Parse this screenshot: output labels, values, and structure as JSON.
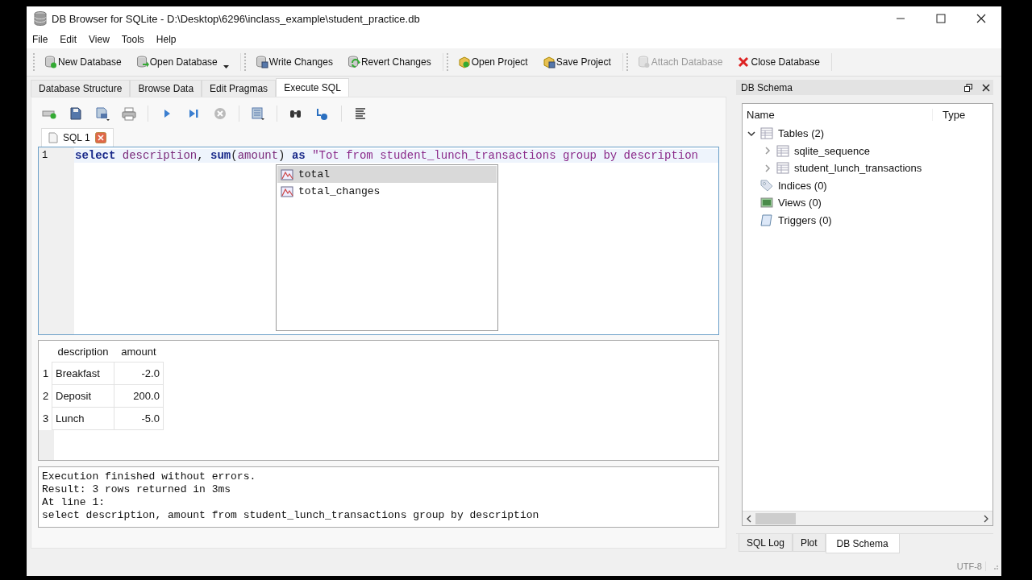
{
  "window": {
    "title": "DB Browser for SQLite - D:\\Desktop\\6296\\inclass_example\\student_practice.db"
  },
  "menu": [
    "File",
    "Edit",
    "View",
    "Tools",
    "Help"
  ],
  "toolbar": {
    "groups": [
      {
        "buttons": [
          {
            "label": "New Database",
            "disabled": false,
            "dropdown": false
          },
          {
            "label": "Open Database",
            "disabled": false,
            "dropdown": true
          }
        ]
      },
      {
        "buttons": [
          {
            "label": "Write Changes",
            "disabled": false,
            "dropdown": false
          },
          {
            "label": "Revert Changes",
            "disabled": false,
            "dropdown": false
          }
        ]
      },
      {
        "buttons": [
          {
            "label": "Open Project",
            "disabled": false,
            "dropdown": false
          },
          {
            "label": "Save Project",
            "disabled": false,
            "dropdown": false
          }
        ]
      },
      {
        "buttons": [
          {
            "label": "Attach Database",
            "disabled": true,
            "dropdown": false
          },
          {
            "label": "Close Database",
            "disabled": false,
            "dropdown": false
          }
        ]
      }
    ]
  },
  "main_tabs": [
    {
      "label": "Database Structure",
      "selected": false
    },
    {
      "label": "Browse Data",
      "selected": false
    },
    {
      "label": "Edit Pragmas",
      "selected": false
    },
    {
      "label": "Execute SQL",
      "selected": true
    }
  ],
  "sql_tabs": [
    {
      "label": "SQL 1"
    }
  ],
  "editor": {
    "lines": [
      {
        "number": "1",
        "tokens": [
          {
            "text": "select ",
            "kind": "keyword"
          },
          {
            "text": "description",
            "kind": "identifier"
          },
          {
            "text": ", ",
            "kind": "plain"
          },
          {
            "text": "sum",
            "kind": "keyword"
          },
          {
            "text": "(",
            "kind": "plain"
          },
          {
            "text": "amount",
            "kind": "identifier"
          },
          {
            "text": ") ",
            "kind": "plain"
          },
          {
            "text": "as ",
            "kind": "keyword"
          },
          {
            "text": "\"Tot from student_lunch_transactions group by description",
            "kind": "string"
          }
        ]
      }
    ]
  },
  "autocomplete": [
    {
      "label": "total",
      "selected": true
    },
    {
      "label": "total_changes",
      "selected": false
    }
  ],
  "results": {
    "columns": [
      "description",
      "amount"
    ],
    "rows": [
      {
        "number": "1",
        "cells": [
          "Breakfast",
          "-2.0"
        ]
      },
      {
        "number": "2",
        "cells": [
          "Deposit",
          "200.0"
        ]
      },
      {
        "number": "3",
        "cells": [
          "Lunch",
          "-5.0"
        ]
      }
    ]
  },
  "message": [
    "Execution finished without errors.",
    "Result: 3 rows returned in 3ms",
    "At line 1:",
    "select description, amount from student_lunch_transactions group by description"
  ],
  "schema": {
    "title": "DB Schema",
    "columns": [
      "Name",
      "Type"
    ],
    "tree": [
      {
        "label": "Tables (2)",
        "kind": "tables",
        "expanded": true,
        "children": [
          {
            "label": "sqlite_sequence",
            "kind": "table",
            "expanded": false
          },
          {
            "label": "student_lunch_transactions",
            "kind": "table",
            "expanded": false
          }
        ]
      },
      {
        "label": "Indices (0)",
        "kind": "indices"
      },
      {
        "label": "Views (0)",
        "kind": "views"
      },
      {
        "label": "Triggers (0)",
        "kind": "triggers"
      }
    ]
  },
  "dock_tabs": [
    {
      "label": "SQL Log",
      "selected": false
    },
    {
      "label": "Plot",
      "selected": false
    },
    {
      "label": "DB Schema",
      "selected": true
    }
  ],
  "status_bar": {
    "encoding": "UTF-8"
  }
}
